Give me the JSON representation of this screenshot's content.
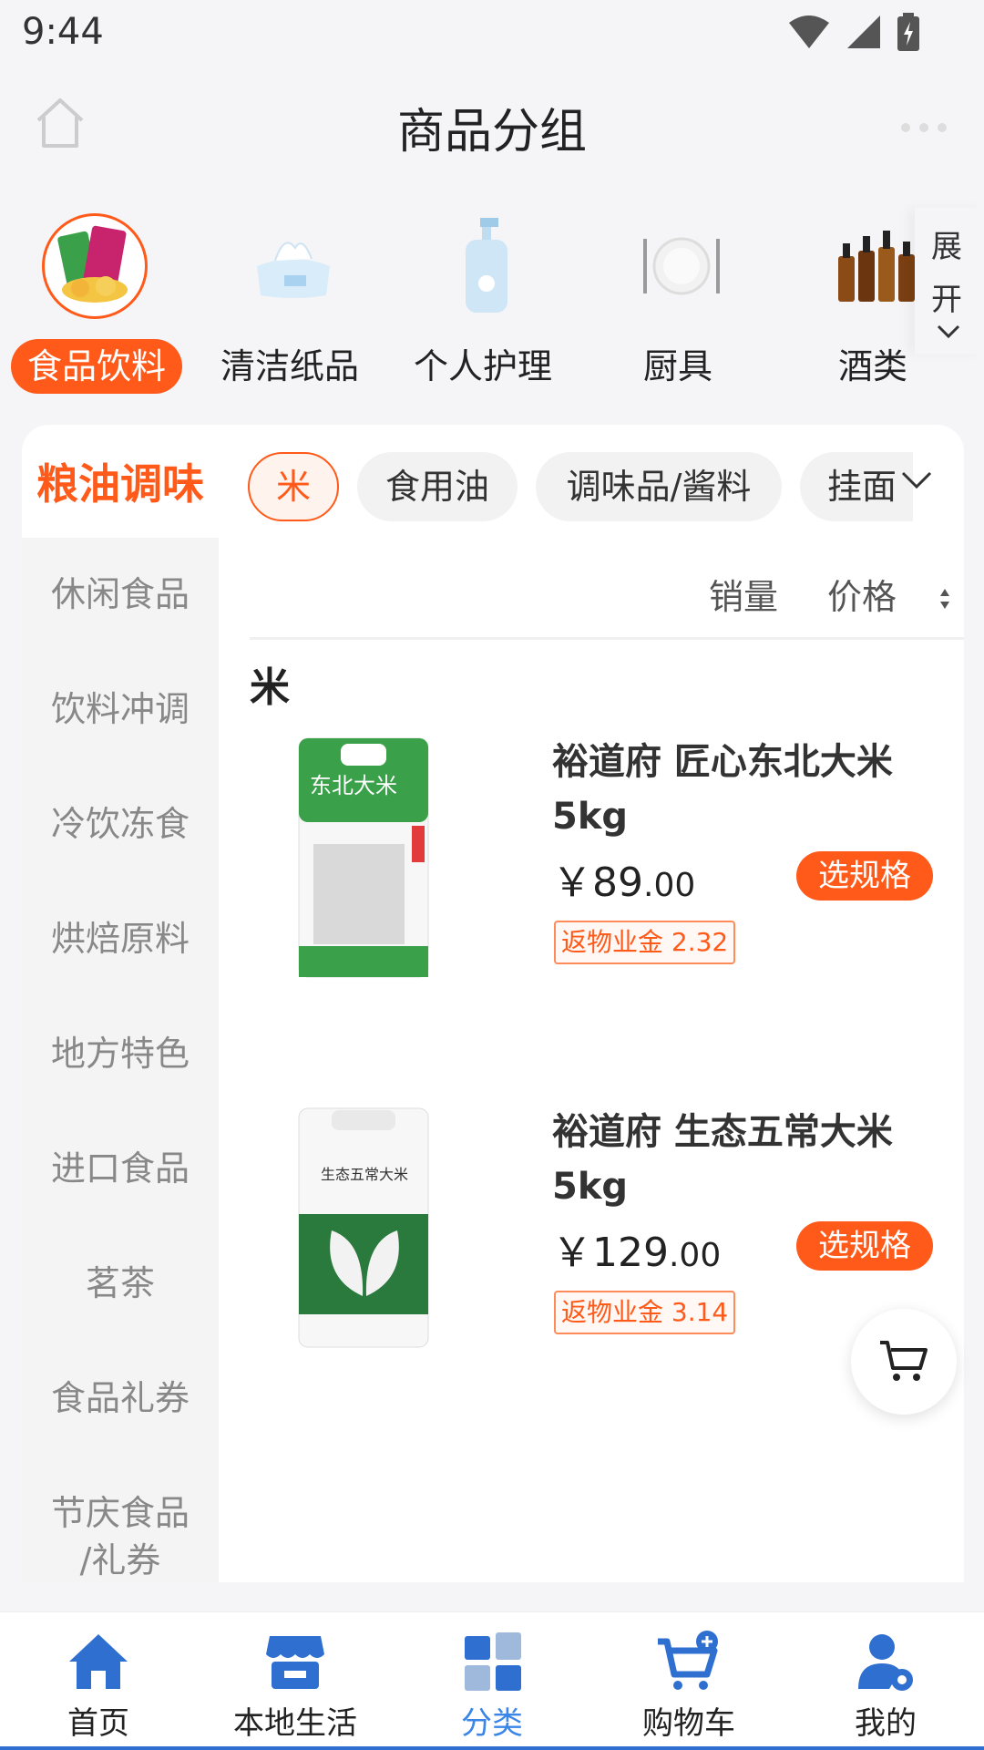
{
  "status_bar": {
    "time": "9:44"
  },
  "nav": {
    "title": "商品分组"
  },
  "categories": [
    {
      "label": "食品饮料",
      "icon": "snacks-icon",
      "active": true
    },
    {
      "label": "清洁纸品",
      "icon": "tissue-icon"
    },
    {
      "label": "个人护理",
      "icon": "lotion-bottle-icon"
    },
    {
      "label": "厨具",
      "icon": "plate-cutlery-icon"
    },
    {
      "label": "酒类",
      "icon": "liquor-bottles-icon"
    }
  ],
  "expand": {
    "label": "展开"
  },
  "sidebar": {
    "active": "粮油调味",
    "items": [
      "休闲食品",
      "饮料冲调",
      "冷饮冻食",
      "烘焙原料",
      "地方特色",
      "进口食品",
      "茗茶",
      "食品礼券",
      "节庆食品\n/礼券"
    ]
  },
  "subcategories": [
    "米",
    "食用油",
    "调味品/酱料",
    "挂面"
  ],
  "sort": {
    "sales": "销量",
    "price": "价格"
  },
  "section": {
    "title": "米"
  },
  "products": [
    {
      "name": "裕道府 匠心东北大米5kg",
      "currency": "￥",
      "price_int": "89",
      "price_dec": ".00",
      "spec_button": "选规格",
      "rebate": "返物业金 2.32",
      "bag_text": "东北大米"
    },
    {
      "name": "裕道府 生态五常大米5kg",
      "currency": "￥",
      "price_int": "129",
      "price_dec": ".00",
      "spec_button": "选规格",
      "rebate": "返物业金 3.14",
      "bag_text": "生态五常大米"
    }
  ],
  "tabs": [
    {
      "label": "首页",
      "icon": "home-icon"
    },
    {
      "label": "本地生活",
      "icon": "store-icon"
    },
    {
      "label": "分类",
      "icon": "category-icon",
      "active": true
    },
    {
      "label": "购物车",
      "icon": "cart-add-icon"
    },
    {
      "label": "我的",
      "icon": "user-settings-icon"
    }
  ],
  "colors": {
    "accent": "#ff5a1a",
    "tab_blue": "#2f6fd0",
    "tab_active_text": "#3a86e8"
  }
}
